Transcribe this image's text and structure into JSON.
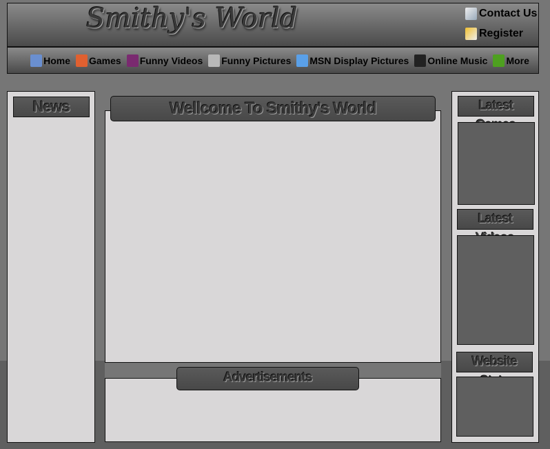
{
  "header": {
    "site_title": "Smithy's World",
    "contact_label": "Contact Us",
    "register_label": "Register"
  },
  "nav": {
    "items": [
      {
        "label": "Home",
        "icon": "home-icon",
        "color": "#6a8fd0"
      },
      {
        "label": "Games",
        "icon": "games-icon",
        "color": "#e06030"
      },
      {
        "label": "Funny Videos",
        "icon": "film-icon",
        "color": "#7a2a70"
      },
      {
        "label": "Funny Pictures",
        "icon": "camera-icon",
        "color": "#b8b8b8"
      },
      {
        "label": "MSN Display Pictures",
        "icon": "user-icon",
        "color": "#5aa0e8"
      },
      {
        "label": "Online Music",
        "icon": "headphones-icon",
        "color": "#222222"
      },
      {
        "label": "More",
        "icon": "more-icon",
        "color": "#4ea020"
      }
    ]
  },
  "left": {
    "news_title": "News"
  },
  "center": {
    "welcome_title": "Wellcome To Smithy's World",
    "ads_title": "Advertisements"
  },
  "right": {
    "games_title": "Latest Games",
    "videos_title": "Latest Videos",
    "stats_title": "Website Stats"
  }
}
